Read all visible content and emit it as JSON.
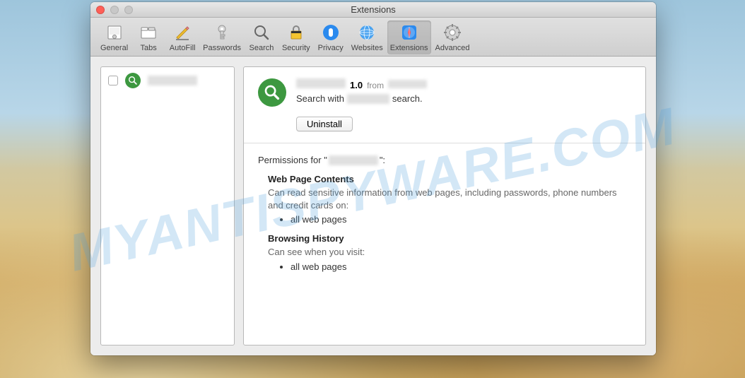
{
  "window": {
    "title": "Extensions"
  },
  "toolbar": {
    "items": [
      {
        "label": "General"
      },
      {
        "label": "Tabs"
      },
      {
        "label": "AutoFill"
      },
      {
        "label": "Passwords"
      },
      {
        "label": "Search"
      },
      {
        "label": "Security"
      },
      {
        "label": "Privacy"
      },
      {
        "label": "Websites"
      },
      {
        "label": "Extensions"
      },
      {
        "label": "Advanced"
      }
    ]
  },
  "detail": {
    "version": "1.0",
    "from_label": "from",
    "desc_prefix": "Search with",
    "desc_suffix": "search.",
    "uninstall_label": "Uninstall",
    "perm_prefix": "Permissions for \"",
    "perm_suffix": "\":",
    "perms": [
      {
        "title": "Web Page Contents",
        "desc": "Can read sensitive information from web pages, including passwords, phone numbers and credit cards on:",
        "bullet": "all web pages"
      },
      {
        "title": "Browsing History",
        "desc": "Can see when you visit:",
        "bullet": "all web pages"
      }
    ]
  },
  "watermark": "MYANTISPYWARE.COM"
}
